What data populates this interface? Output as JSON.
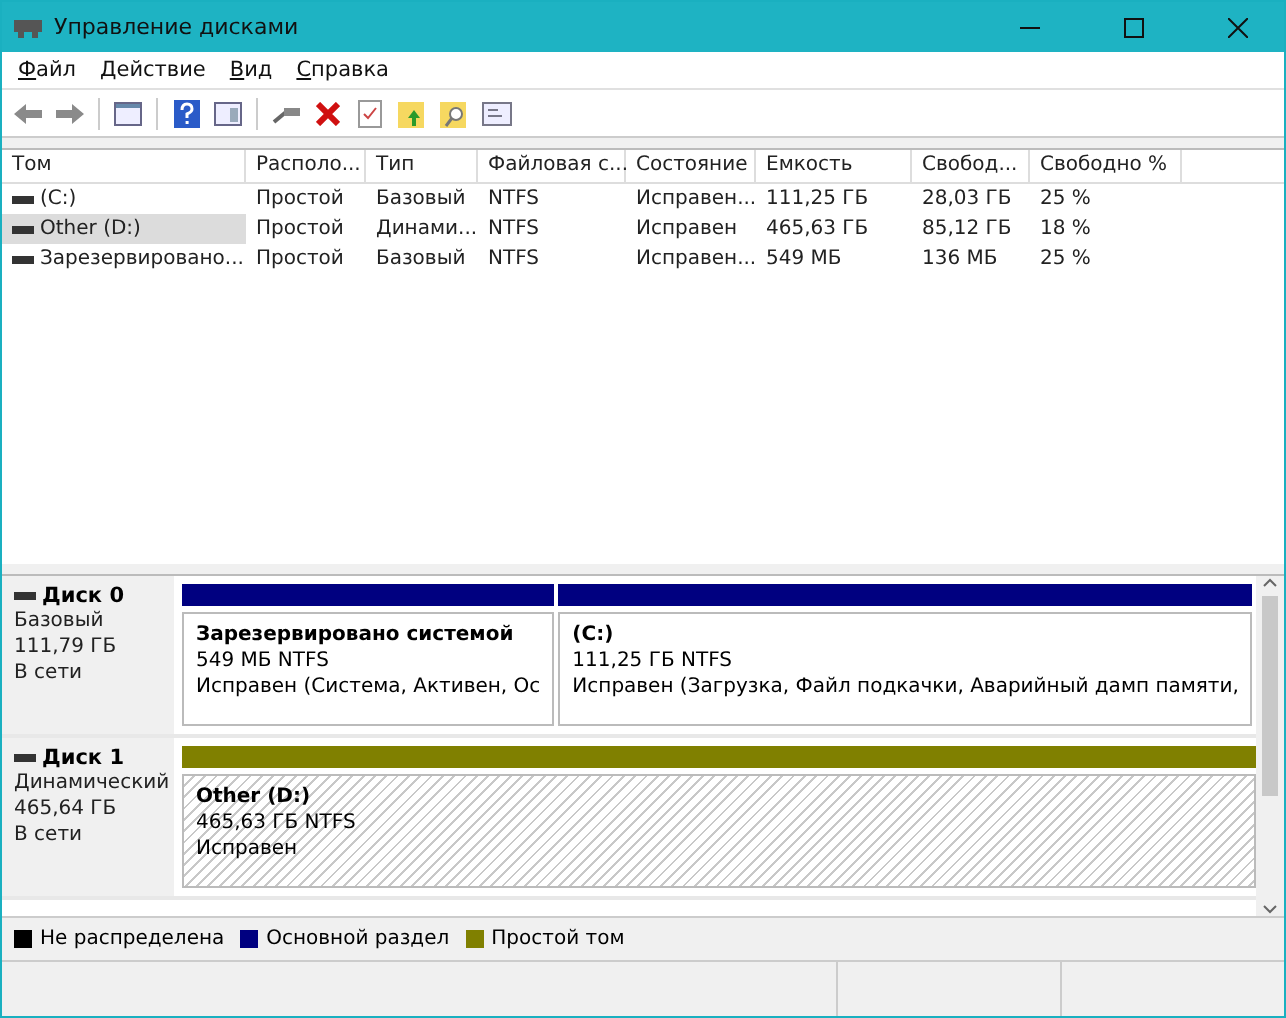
{
  "window": {
    "title": "Управление дисками"
  },
  "menu": [
    "Файл",
    "Действие",
    "Вид",
    "Справка"
  ],
  "table": {
    "columns": [
      "Том",
      "Располо...",
      "Тип",
      "Файловая с...",
      "Состояние",
      "Емкость",
      "Свобод...",
      "Свободно %"
    ],
    "rows": [
      {
        "selected": false,
        "cells": [
          "(C:)",
          "Простой",
          "Базовый",
          "NTFS",
          "Исправен...",
          "111,25 ГБ",
          "28,03 ГБ",
          "25 %"
        ]
      },
      {
        "selected": true,
        "cells": [
          "Other (D:)",
          "Простой",
          "Динами...",
          "NTFS",
          "Исправен",
          "465,63 ГБ",
          "85,12 ГБ",
          "18 %"
        ]
      },
      {
        "selected": false,
        "cells": [
          "Зарезервировано...",
          "Простой",
          "Базовый",
          "NTFS",
          "Исправен...",
          "549 МБ",
          "136 МБ",
          "25 %"
        ]
      }
    ]
  },
  "disks": [
    {
      "name": "Диск 0",
      "type": "Базовый",
      "size": "111,79 ГБ",
      "status": "В сети",
      "partitions": [
        {
          "kind": "primary",
          "selected": false,
          "name": "Зарезервировано системой",
          "size": "549 МБ NTFS",
          "status": "Исправен (Система, Активен, Ос"
        },
        {
          "kind": "primary",
          "selected": false,
          "name": "(C:)",
          "size": "111,25 ГБ NTFS",
          "status": "Исправен (Загрузка, Файл подкачки, Аварийный дамп памяти,"
        }
      ]
    },
    {
      "name": "Диск 1",
      "type": "Динамический",
      "size": "465,64 ГБ",
      "status": "В сети",
      "partitions": [
        {
          "kind": "simple",
          "selected": true,
          "name": "Other  (D:)",
          "size": "465,63 ГБ NTFS",
          "status": "Исправен"
        }
      ]
    }
  ],
  "legend": [
    {
      "label": "Не распределена",
      "color": "#000000"
    },
    {
      "label": "Основной раздел",
      "color": "#000080"
    },
    {
      "label": "Простой том",
      "color": "#808000"
    }
  ]
}
